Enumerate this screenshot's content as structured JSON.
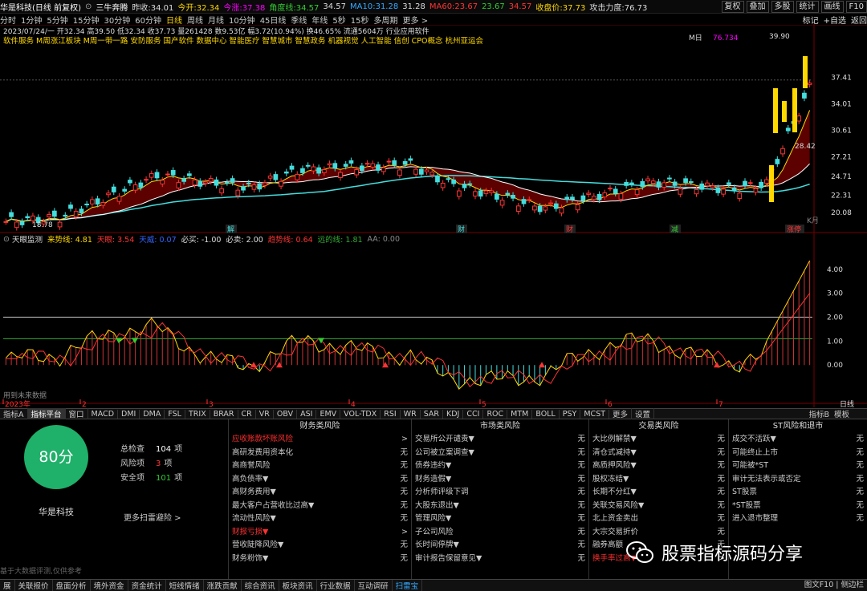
{
  "title": {
    "name": "华是科技(日线 前复权)",
    "indicator": "三牛奔腾",
    "prev_close": "昨收:34.01",
    "open": "今开:32.34",
    "rise": "今涨:37.38",
    "angle": "角度线:34.57",
    "ma_a": "34.57",
    "ma10": "MA10:31.28",
    "ma_b": "31.28",
    "ma60": "MA60:23.67",
    "ma_c": "23.67",
    "ma_d": "34.57",
    "close_price": "收盘价:37.73",
    "attack": "攻击力度:76.73"
  },
  "toolbar_right": [
    "复权",
    "叠加",
    "多股",
    "统计",
    "画线",
    "F10",
    "标记",
    "+自选",
    "返回"
  ],
  "periods": [
    "分时",
    "1分钟",
    "5分钟",
    "15分钟",
    "30分钟",
    "60分钟",
    "日线",
    "周线",
    "月线",
    "10分钟",
    "45日线",
    "季线",
    "年线",
    "5秒",
    "15秒",
    "多周期",
    "更多 >"
  ],
  "active_period": "日线",
  "info_line1": "2023/07/24/一 开32.34 高39.50 低32.34 收37.73 量261428 数9.53亿 幅3.72(10.94%) 换46.65% 流通5604万 行业应用软件",
  "info_line2": "软件服务 M周涨江板块 M周一带一路 安防服务 国产软件 数据中心 智能医疗 智慧城市 智慧政务 机器视觉 人工智能 信创 CPO概念 杭州亚运会",
  "chart_data": [
    {
      "type": "candlestick",
      "title": "华是科技(日线 前复权)",
      "y_ticks": [
        37.41,
        34.01,
        30.61,
        27.21,
        24.71,
        22.31,
        20.08
      ],
      "annotations": [
        "18.78",
        "39.90",
        "28.42",
        "76.734",
        "M日",
        "K月"
      ],
      "event_marks": [
        "解",
        "财",
        "财",
        "减",
        "涨停"
      ],
      "x_ticks": [
        "2023年",
        "2",
        "3",
        "4",
        "5",
        "6",
        "7"
      ],
      "ylim": [
        17.5,
        41.5
      ]
    },
    {
      "type": "line",
      "title": "天眼监测",
      "y_ticks": [
        4.0,
        3.0,
        2.0,
        1.0,
        0.0
      ],
      "ylim": [
        -1.6,
        5.0
      ],
      "legend": [
        "来势线: 4.81",
        "天眼: 3.54",
        "天威: 0.07",
        "必买: -1.00",
        "必卖: 2.00",
        "趋势线: 0.64",
        "远的线: 1.81",
        "AA: 0.00"
      ],
      "footnote": "用到未来数据"
    }
  ],
  "tabs": [
    "指标A",
    "指标平台",
    "窗口",
    "MACD",
    "DMI",
    "DMA",
    "FSL",
    "TRIX",
    "BRAR",
    "CR",
    "VR",
    "OBV",
    "ASI",
    "EMV",
    "VOL-TDX",
    "RSI",
    "WR",
    "SAR",
    "KDJ",
    "CCI",
    "ROC",
    "MTM",
    "BOLL",
    "PSY",
    "MCST",
    "更多",
    "设置"
  ],
  "tabs_right": [
    "指标B",
    "模板"
  ],
  "score": {
    "value": "80分",
    "stock": "华是科技",
    "total_label": "总检查",
    "total": "104",
    "risk_label": "风险项",
    "risk": "3",
    "safe_label": "安全项",
    "safe": "101",
    "unit": "项",
    "more": "更多扫雷避险 >"
  },
  "risk": [
    {
      "title": "财务类风险",
      "items": [
        {
          "n": "应收账款坏账风险",
          "v": ">",
          "red": true
        },
        {
          "n": "高研发费用资本化",
          "v": "无"
        },
        {
          "n": "高商誉风险",
          "v": "无"
        },
        {
          "n": "高负债率▼",
          "v": "无"
        },
        {
          "n": "高财务费用▼",
          "v": "无"
        },
        {
          "n": "最大客户占营收比过高▼",
          "v": "无"
        },
        {
          "n": "流动性风险▼",
          "v": "无"
        },
        {
          "n": "财报亏损▼",
          "v": ">",
          "red": true
        },
        {
          "n": "营收陡降风险▼",
          "v": "无"
        },
        {
          "n": "财务粉饰▼",
          "v": "无"
        }
      ]
    },
    {
      "title": "市场类风险",
      "items": [
        {
          "n": "交易所公开谴责▼",
          "v": "无"
        },
        {
          "n": "公司被立案调查▼",
          "v": "无"
        },
        {
          "n": "债券违约▼",
          "v": "无"
        },
        {
          "n": "财务造假▼",
          "v": "无"
        },
        {
          "n": "分析师评级下调",
          "v": "无"
        },
        {
          "n": "大股东退出▼",
          "v": "无"
        },
        {
          "n": "管理风险▼",
          "v": "无"
        },
        {
          "n": "子公司风险",
          "v": "无"
        },
        {
          "n": "长时间停牌▼",
          "v": "无"
        },
        {
          "n": "审计报告保留意见▼",
          "v": "无"
        }
      ]
    },
    {
      "title": "交易类风险",
      "items": [
        {
          "n": "大比例解禁▼",
          "v": "无"
        },
        {
          "n": "清仓式减持▼",
          "v": "无"
        },
        {
          "n": "高质押风险▼",
          "v": "无"
        },
        {
          "n": "股权冻结▼",
          "v": "无"
        },
        {
          "n": "长期不分红▼",
          "v": "无"
        },
        {
          "n": "关联交易风险▼",
          "v": "无"
        },
        {
          "n": "北上资金卖出",
          "v": "无"
        },
        {
          "n": "大宗交易折价",
          "v": "无"
        },
        {
          "n": "融券高额",
          "v": "无"
        },
        {
          "n": "换手率过高▼",
          "v": ">",
          "red": true
        }
      ]
    },
    {
      "title": "ST风险和退市",
      "items": [
        {
          "n": "成交不活跃▼",
          "v": "无"
        },
        {
          "n": "可能终止上市",
          "v": "无"
        },
        {
          "n": "可能被*ST",
          "v": "无"
        },
        {
          "n": "审计无法表示或否定",
          "v": "无"
        },
        {
          "n": "ST股票",
          "v": "无"
        },
        {
          "n": "*ST股票",
          "v": "无"
        },
        {
          "n": "进入退市整理",
          "v": "无"
        }
      ]
    }
  ],
  "disclaimer": "基于大数据评测,仅供参考",
  "status": [
    "展",
    "关联报价",
    "盘面分析",
    "境外资金",
    "资金统计",
    "短线情绪",
    "涨跌贡献",
    "综合资讯",
    "板块资讯",
    "行业数据",
    "互动调研",
    "扫雷宝"
  ],
  "status_active": "扫雷宝",
  "status_right": "图文F10 | 侧边栏",
  "watermark": "股票指标源码分享"
}
